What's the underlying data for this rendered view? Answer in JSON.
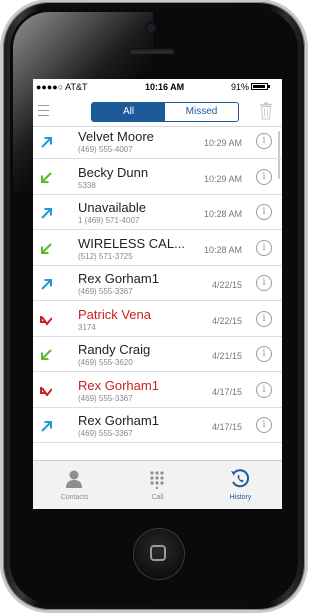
{
  "status_bar": {
    "carrier": "●●●●○ AT&T",
    "time": "10:16 AM",
    "battery": "91%",
    "battery_level": 0.91
  },
  "toolbar": {
    "segments": [
      {
        "label": "All",
        "selected": true
      },
      {
        "label": "Missed",
        "selected": false
      }
    ]
  },
  "calls": [
    {
      "name": "Velvet Moore",
      "number": "(469) 555-4007",
      "time": "10:29 AM",
      "direction": "outgoing",
      "missed": false
    },
    {
      "name": "Becky Dunn",
      "number": "5338",
      "time": "10:29 AM",
      "direction": "incoming",
      "missed": false
    },
    {
      "name": "Unavailable",
      "number": "1 (469) 571-4007",
      "time": "10:28 AM",
      "direction": "outgoing",
      "missed": false
    },
    {
      "name": "WIRELESS CAL...",
      "number": "(512) 571-3725",
      "time": "10:28 AM",
      "direction": "incoming",
      "missed": false
    },
    {
      "name": "Rex Gorham1",
      "number": "(469) 555-3367",
      "time": "4/22/15",
      "direction": "outgoing",
      "missed": false
    },
    {
      "name": "Patrick Vena",
      "number": "3174",
      "time": "4/22/15",
      "direction": "missed",
      "missed": true
    },
    {
      "name": "Randy Craig",
      "number": "(469) 555-3620",
      "time": "4/21/15",
      "direction": "incoming",
      "missed": false
    },
    {
      "name": "Rex Gorham1",
      "number": "(469) 555-3367",
      "time": "4/17/15",
      "direction": "missed",
      "missed": true
    },
    {
      "name": "Rex Gorham1",
      "number": "(469) 555-3367",
      "time": "4/17/15",
      "direction": "outgoing",
      "missed": false
    }
  ],
  "colors": {
    "accent": "#1c5a99",
    "outgoing": "#1e9ad6",
    "incoming": "#5cb82e",
    "missed": "#cc1f1f"
  },
  "tabbar": {
    "tabs": [
      {
        "label": "Contacts",
        "icon": "person-icon",
        "active": false
      },
      {
        "label": "Call",
        "icon": "keypad-icon",
        "active": false
      },
      {
        "label": "History",
        "icon": "clock-phone-icon",
        "active": true
      }
    ]
  }
}
